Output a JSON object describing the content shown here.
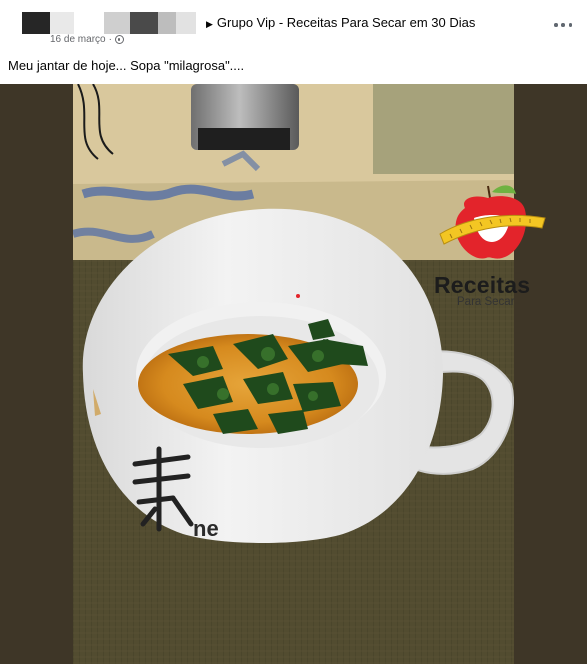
{
  "post": {
    "group_name": "Grupo Vip - Receitas Para Secar em 30 Dias",
    "date": "16 de março",
    "caption": "Meu jantar de hoje... Sopa \"milagrosa\"....",
    "more_icon": "more-horizontal-icon",
    "privacy_icon": "globe-icon"
  },
  "photo": {
    "description_icon": "soup-bowl-photo",
    "watermark": {
      "title": "Receitas",
      "subtitle": "Para Secar"
    }
  },
  "colors": {
    "text": "#050505",
    "secondary_text": "#65676b",
    "photo_background": "#3e3627",
    "watermark_red": "#e3242b",
    "watermark_yellow": "#f3c623"
  }
}
